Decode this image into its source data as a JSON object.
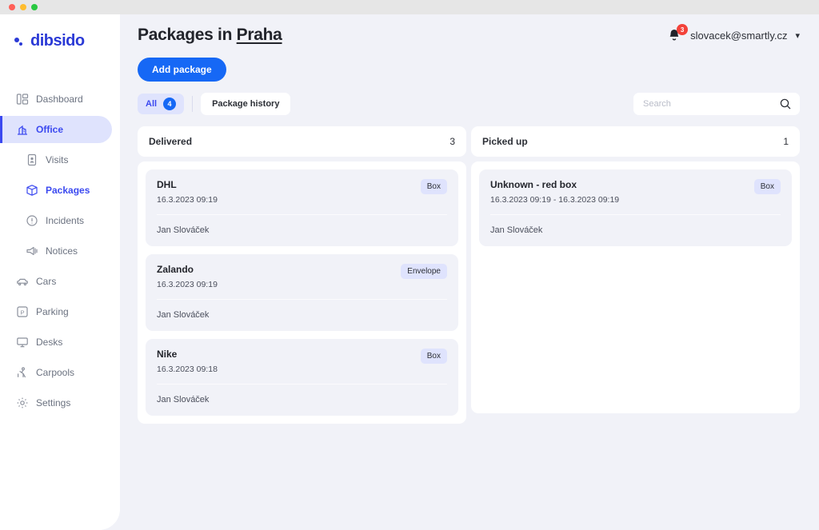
{
  "window": {
    "traffic_lights": [
      "close",
      "minimize",
      "maximize"
    ]
  },
  "sidebar": {
    "brand": "dibsido",
    "items": [
      {
        "label": "Dashboard",
        "icon": "dashboard-icon",
        "state": "default",
        "level": "top"
      },
      {
        "label": "Office",
        "icon": "office-building-icon",
        "state": "active",
        "level": "top"
      },
      {
        "label": "Visits",
        "icon": "visits-badge-icon",
        "state": "default",
        "level": "sub"
      },
      {
        "label": "Packages",
        "icon": "package-box-icon",
        "state": "current",
        "level": "sub"
      },
      {
        "label": "Incidents",
        "icon": "alert-circle-icon",
        "state": "default",
        "level": "sub"
      },
      {
        "label": "Notices",
        "icon": "megaphone-icon",
        "state": "default",
        "level": "sub"
      },
      {
        "label": "Cars",
        "icon": "car-icon",
        "state": "default",
        "level": "top"
      },
      {
        "label": "Parking",
        "icon": "parking-p-icon",
        "state": "default",
        "level": "top"
      },
      {
        "label": "Desks",
        "icon": "monitor-desk-icon",
        "state": "default",
        "level": "top"
      },
      {
        "label": "Carpools",
        "icon": "carpool-person-icon",
        "state": "default",
        "level": "top"
      }
    ],
    "bottom": {
      "label": "Settings",
      "icon": "gear-icon"
    }
  },
  "header": {
    "title_prefix": "Packages in ",
    "title_location": "Praha",
    "notifications": {
      "icon": "bell-icon",
      "count": "3"
    },
    "account_email": "slovacek@smartly.cz",
    "caret_icon": "chevron-down-icon"
  },
  "toolbar": {
    "add_package_label": "Add package",
    "filter_all_label": "All",
    "filter_all_count": "4",
    "package_history_label": "Package history"
  },
  "search": {
    "placeholder": "Search",
    "value": "",
    "icon": "search-icon"
  },
  "columns": [
    {
      "title": "Delivered",
      "count": "3",
      "packages": [
        {
          "name": "DHL",
          "date": "16.3.2023 09:19",
          "badge": "Box",
          "person": "Jan Slováček"
        },
        {
          "name": "Zalando",
          "date": "16.3.2023 09:19",
          "badge": "Envelope",
          "person": "Jan Slováček"
        },
        {
          "name": "Nike",
          "date": "16.3.2023 09:18",
          "badge": "Box",
          "person": "Jan Slováček"
        }
      ]
    },
    {
      "title": "Picked up",
      "count": "1",
      "packages": [
        {
          "name": "Unknown - red box",
          "date": "16.3.2023 09:19 - 16.3.2023 09:19",
          "badge": "Box",
          "person": "Jan Slováček"
        }
      ]
    }
  ],
  "colors": {
    "brand": "#2b3ad6",
    "accent": "#1668f5",
    "active_bg": "#dfe3fd",
    "app_bg": "#f1f2f8",
    "card_bg": "#ffffff",
    "badge_red": "#f3423a",
    "text_dark": "#22242b",
    "text_muted": "#6b7280"
  }
}
